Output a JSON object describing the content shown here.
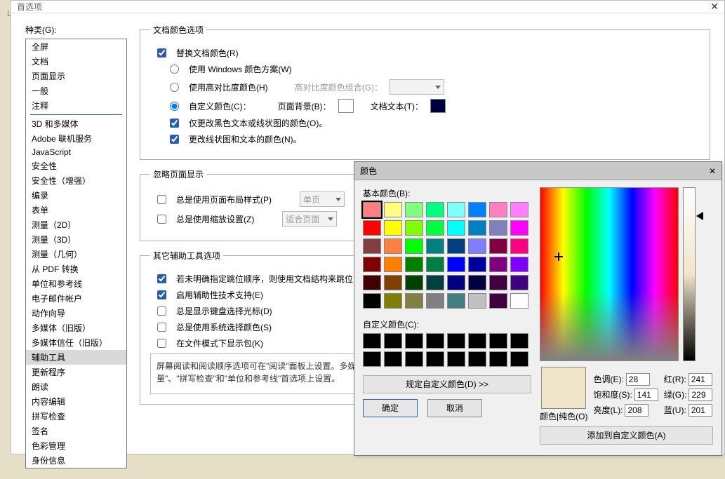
{
  "prefs": {
    "title": "首选项",
    "categories_label": "种类(G):",
    "categories_top": [
      "全屏",
      "文档",
      "页面显示",
      "一般",
      "注释"
    ],
    "categories_rest": [
      "3D 和多媒体",
      "Adobe 联机服务",
      "JavaScript",
      "安全性",
      "安全性（增强）",
      "编录",
      "表单",
      "测量（2D）",
      "测量（3D）",
      "测量（几何）",
      "从 PDF 转换",
      "单位和参考线",
      "电子邮件帐户",
      "动作向导",
      "多媒体（旧版）",
      "多媒体信任（旧版）",
      "辅助工具",
      "更新程序",
      "朗读",
      "内容编辑",
      "拼写检查",
      "签名",
      "色彩管理",
      "身份信息"
    ],
    "selected_category": "辅助工具",
    "doc_colors": {
      "legend": "文档颜色选项",
      "replace": "替换文档颜色(R)",
      "use_windows": "使用 Windows 颜色方案(W)",
      "use_high_contrast": "使用高对比度颜色(H)",
      "hc_combo_label": "高对比度颜色组合(G)：",
      "custom_colors": "自定义颜色(C)：",
      "page_bg": "页面背景(B)：",
      "doc_text": "文档文本(T)：",
      "page_bg_color": "#ffffff",
      "doc_text_color": "#00003a",
      "only_black": "仅更改黑色文本或线状图的颜色(O)。",
      "change_lines": "更改线状图和文本的颜色(N)。"
    },
    "page_display": {
      "legend": "忽略页面显示",
      "always_layout": "总是使用页面布局样式(P)",
      "layout_value": "单页",
      "always_zoom": "总是使用缩放设置(Z)",
      "zoom_value": "适合页面"
    },
    "other": {
      "legend": "其它辅助工具选项",
      "tab_order": "若未明确指定跳位顺序，则使用文档结构来跳位",
      "enable_assistive": "启用辅助性技术支持(E)",
      "show_keyboard_cursor": "总是显示键盘选择光标(D)",
      "use_system_select": "总是使用系统选择颜色(S)",
      "show_pkg": "在文件模式下显示包(K)",
      "desc": "屏幕阅读和阅读顺序选项可在\"阅读\"面板上设置。多媒体辅助工具选项可在\"多媒体\"面板上设置。其它与辅助工具有关的选项可在\"表单\"、\"测量\"、\"拼写检查\"和\"单位和参考线\"首选项上设置。"
    }
  },
  "color": {
    "title": "颜色",
    "basic_label": "基本颜色(B):",
    "custom_label": "自定义颜色(C):",
    "basic_colors": [
      "#ff8080",
      "#ffff80",
      "#80ff80",
      "#00ff80",
      "#80ffff",
      "#0080ff",
      "#ff80c0",
      "#ff80ff",
      "#ff0000",
      "#ffff00",
      "#80ff00",
      "#00ff40",
      "#00ffff",
      "#0080c0",
      "#8080c0",
      "#ff00ff",
      "#804040",
      "#ff8040",
      "#00ff00",
      "#008080",
      "#004080",
      "#8080ff",
      "#800040",
      "#ff0080",
      "#800000",
      "#ff8000",
      "#008000",
      "#008040",
      "#0000ff",
      "#0000a0",
      "#800080",
      "#8000ff",
      "#400000",
      "#804000",
      "#004000",
      "#004040",
      "#000080",
      "#000040",
      "#400040",
      "#400080",
      "#000000",
      "#808000",
      "#808040",
      "#808080",
      "#408080",
      "#c0c0c0",
      "#400040",
      "#ffffff"
    ],
    "define_btn": "规定自定义颜色(D) >>",
    "ok": "确定",
    "cancel": "取消",
    "hue_label": "色调(E):",
    "sat_label": "饱和度(S):",
    "lum_label": "亮度(L):",
    "red_label": "红(R):",
    "green_label": "绿(G):",
    "blue_label": "蓝(U):",
    "hue": "28",
    "sat": "141",
    "lum": "208",
    "red": "241",
    "green": "229",
    "blue": "201",
    "pure_label": "颜色|纯色(O)",
    "add_btn": "添加到自定义颜色(A)",
    "preview_color": "#f1e5c9"
  }
}
